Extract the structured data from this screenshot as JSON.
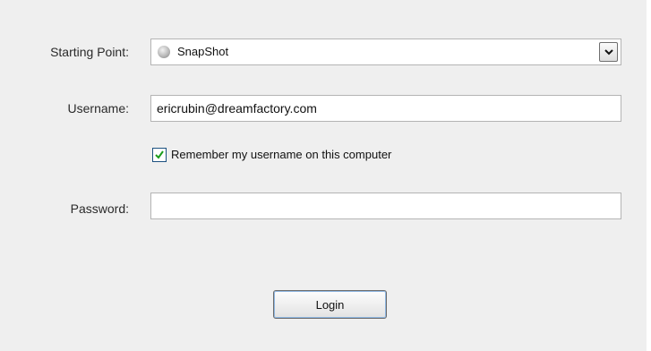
{
  "form": {
    "starting_point": {
      "label": "Starting Point:",
      "selected": "SnapShot",
      "icon": "globe-icon"
    },
    "username": {
      "label": "Username:",
      "value": "ericrubin@dreamfactory.com"
    },
    "remember": {
      "label": "Remember my username on this computer",
      "checked": true
    },
    "password": {
      "label": "Password:",
      "value": ""
    },
    "login_label": "Login"
  },
  "colors": {
    "panel_background": "#efefef",
    "check_mark": "#1a9c1a",
    "button_focus": "#8fb7e2"
  }
}
